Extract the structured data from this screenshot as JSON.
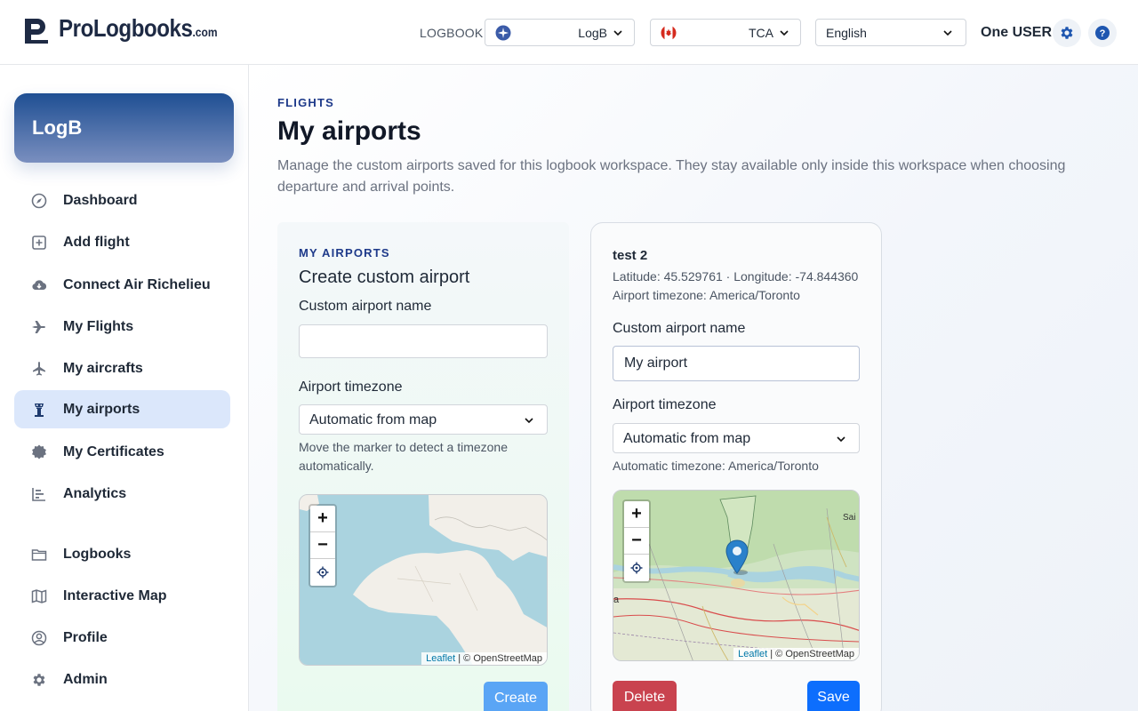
{
  "header": {
    "brand": "ProLogbooks",
    "brand_suffix": ".com",
    "logbook_label": "LOGBOOK",
    "logbook_value": "LogB",
    "authority_value": "TCA",
    "language_value": "English",
    "user_name": "One USER"
  },
  "sidebar": {
    "workspace": "LogB",
    "items": [
      {
        "label": "Dashboard",
        "icon": "compass-icon"
      },
      {
        "label": "Add flight",
        "icon": "plus-square-icon"
      },
      {
        "label": "Connect Air Richelieu",
        "icon": "cloud-download-icon"
      },
      {
        "label": "My Flights",
        "icon": "airplane-icon"
      },
      {
        "label": "My aircrafts",
        "icon": "airplane-up-icon"
      },
      {
        "label": "My airports",
        "icon": "control-tower-icon",
        "active": true
      },
      {
        "label": "My Certificates",
        "icon": "badge-icon"
      },
      {
        "label": "Analytics",
        "icon": "bar-chart-icon"
      },
      {
        "label": "Logbooks",
        "icon": "folder-icon"
      },
      {
        "label": "Interactive Map",
        "icon": "map-icon"
      },
      {
        "label": "Profile",
        "icon": "user-circle-icon"
      },
      {
        "label": "Admin",
        "icon": "gear-icon"
      }
    ]
  },
  "page": {
    "eyebrow": "FLIGHTS",
    "title": "My airports",
    "description": "Manage the custom airports saved for this logbook workspace. They stay available only inside this workspace when choosing departure and arrival points."
  },
  "create_card": {
    "eyebrow": "MY AIRPORTS",
    "title": "Create custom airport",
    "name_label": "Custom airport name",
    "name_value": "",
    "timezone_label": "Airport timezone",
    "timezone_value": "Automatic from map",
    "hint": "Move the marker to detect a timezone automatically.",
    "create_label": "Create"
  },
  "edit_card": {
    "airport_name": "test 2",
    "coords": "Latitude: 45.529761 · Longitude: -74.844360",
    "timezone_info": "Airport timezone: America/Toronto",
    "name_label": "Custom airport name",
    "name_value": "My airport",
    "timezone_label": "Airport timezone",
    "timezone_value": "Automatic from map",
    "auto_timezone": "Automatic timezone: America/Toronto",
    "delete_label": "Delete",
    "save_label": "Save"
  },
  "map": {
    "zoom_in": "+",
    "zoom_out": "−",
    "attribution_link": "Leaflet",
    "attribution_text": " | © OpenStreetMap",
    "edge_label_city": "Sai",
    "edge_label_left": "a"
  },
  "colors": {
    "accent": "#0d6efd",
    "create_button": "#5aa5f5",
    "delete_button": "#c9434f",
    "marker": "#2a81cb"
  }
}
